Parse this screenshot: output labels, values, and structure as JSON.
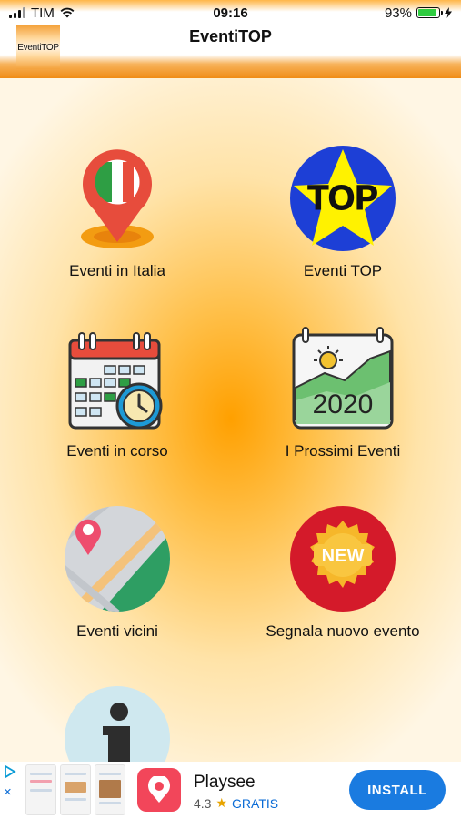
{
  "status": {
    "carrier": "TIM",
    "time": "09:16",
    "battery": "93%",
    "battery_level": 0.93
  },
  "header": {
    "logo_text": "EventiTOP",
    "title": "EventiTOP"
  },
  "menu": [
    {
      "label": "Eventi in Italia",
      "icon": "italy-pin-icon"
    },
    {
      "label": "Eventi TOP",
      "icon": "top-star-icon",
      "icon_text": "TOP"
    },
    {
      "label": "Eventi in corso",
      "icon": "calendar-clock-icon"
    },
    {
      "label": "I Prossimi Eventi",
      "icon": "calendar-2020-icon",
      "icon_text": "2020"
    },
    {
      "label": "Eventi vicini",
      "icon": "map-pin-icon"
    },
    {
      "label": "Segnala nuovo evento",
      "icon": "new-badge-icon",
      "icon_text": "NEW"
    },
    {
      "label": "",
      "icon": "info-icon"
    }
  ],
  "ad": {
    "app_name": "Playsee",
    "rating": "4.3",
    "price": "GRATIS",
    "install_label": "INSTALL",
    "close_icon": "×"
  },
  "colors": {
    "accent": "#ffa000",
    "install": "#1a7be0"
  }
}
